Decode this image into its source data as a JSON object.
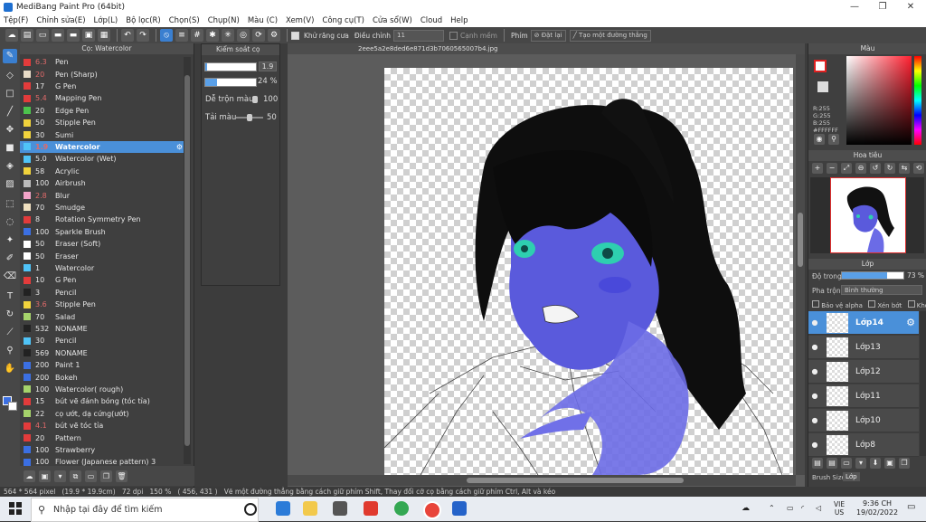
{
  "window": {
    "title": "MediBang Paint Pro (64bit)",
    "controls": {
      "minimize": "—",
      "maximize": "❐",
      "close": "✕"
    }
  },
  "menu": [
    "Tệp(F)",
    "Chỉnh sửa(E)",
    "Lớp(L)",
    "Bộ lọc(R)",
    "Chọn(S)",
    "Chụp(N)",
    "Màu (C)",
    "Xem(V)",
    "Công cụ(T)",
    "Cửa sổ(W)",
    "Cloud",
    "Help"
  ],
  "toolbar": {
    "antialias_label": "Khử răng cưa",
    "adjust_label": "Điều chỉnh",
    "adjust_value": "11",
    "soft_edge_label": "Cạnh mềm",
    "key_label": "Phím",
    "reset_label": "Đặt lại",
    "line_label": "Tạo một đường thẳng"
  },
  "brush_panel": {
    "title": "Cọ: Watercolor",
    "items": [
      {
        "size": "6.3",
        "name": "Pen",
        "color": "#e23b3b",
        "size_red": true
      },
      {
        "size": "20",
        "name": "Pen (Sharp)",
        "color": "#e8dcc8",
        "size_red": true
      },
      {
        "size": "17",
        "name": "G Pen",
        "color": "#e23b3b",
        "size_red": false
      },
      {
        "size": "5.4",
        "name": "Mapping Pen",
        "color": "#e23b3b",
        "size_red": true
      },
      {
        "size": "20",
        "name": "Edge Pen",
        "color": "#4cc24c",
        "size_red": false
      },
      {
        "size": "50",
        "name": "Stipple Pen",
        "color": "#f0d23c",
        "size_red": false
      },
      {
        "size": "30",
        "name": "Sumi",
        "color": "#f0d23c",
        "size_red": false
      },
      {
        "size": "1.9",
        "name": "Watercolor",
        "color": "#4fc3f7",
        "size_red": true,
        "selected": true
      },
      {
        "size": "5.0",
        "name": "Watercolor (Wet)",
        "color": "#4fc3f7",
        "size_red": false
      },
      {
        "size": "58",
        "name": "Acrylic",
        "color": "#f0d23c",
        "size_red": false
      },
      {
        "size": "100",
        "name": "Airbrush",
        "color": "#bbbbbb",
        "size_red": false
      },
      {
        "size": "2.8",
        "name": "Blur",
        "color": "#f2a3c8",
        "size_red": true
      },
      {
        "size": "70",
        "name": "Smudge",
        "color": "#f0e0c0",
        "size_red": false
      },
      {
        "size": "8",
        "name": "Rotation Symmetry Pen",
        "color": "#e23b3b",
        "size_red": false
      },
      {
        "size": "100",
        "name": "Sparkle Brush",
        "color": "#3b6fe2",
        "size_red": false
      },
      {
        "size": "50",
        "name": "Eraser (Soft)",
        "color": "#ffffff",
        "size_red": false
      },
      {
        "size": "50",
        "name": "Eraser",
        "color": "#ffffff",
        "size_red": false
      },
      {
        "size": "1",
        "name": "Watercolor",
        "color": "#4fc3f7",
        "size_red": false
      },
      {
        "size": "10",
        "name": "G Pen",
        "color": "#e23b3b",
        "size_red": false
      },
      {
        "size": "3",
        "name": "Pencil",
        "color": "#222222",
        "size_red": false
      },
      {
        "size": "3.6",
        "name": "Stipple Pen",
        "color": "#f0d23c",
        "size_red": true
      },
      {
        "size": "70",
        "name": "Salad",
        "color": "#a5d36b",
        "size_red": false
      },
      {
        "size": "532",
        "name": "NONAME",
        "color": "#222222",
        "size_red": false
      },
      {
        "size": "30",
        "name": "Pencil",
        "color": "#4fc3f7",
        "size_red": false
      },
      {
        "size": "569",
        "name": "NONAME",
        "color": "#222222",
        "size_red": false
      },
      {
        "size": "200",
        "name": "Paint 1",
        "color": "#3b6fe2",
        "size_red": false
      },
      {
        "size": "200",
        "name": "Bokeh",
        "color": "#3b6fe2",
        "size_red": false
      },
      {
        "size": "100",
        "name": "Watercolor( rough)",
        "color": "#a5d36b",
        "size_red": false
      },
      {
        "size": "15",
        "name": "bút vẽ đánh bóng (tóc tỉa)",
        "color": "#e23b3b",
        "size_red": false
      },
      {
        "size": "22",
        "name": "cọ ướt, dạ cứng(ướt)",
        "color": "#a5d36b",
        "size_red": false
      },
      {
        "size": "4.1",
        "name": "bút vẽ tóc tỉa",
        "color": "#e23b3b",
        "size_red": true
      },
      {
        "size": "20",
        "name": "Pattern",
        "color": "#e23b3b",
        "size_red": false
      },
      {
        "size": "100",
        "name": "Strawberry",
        "color": "#3b6fe2",
        "size_red": false
      },
      {
        "size": "100",
        "name": "Flower (Japanese pattern) 3",
        "color": "#3b6fe2",
        "size_red": false
      }
    ]
  },
  "brush_control": {
    "title": "Kiểm soát cọ",
    "size_value": "1.9",
    "opacity_value": "24 %",
    "opacity_fraction": 0.24,
    "blend_label": "Dễ trộn màu",
    "blend_value": "100",
    "reload_label": "Tải màu",
    "reload_value": "50"
  },
  "canvas": {
    "tab_name": "2eee5a2e8ded6e871d3b7060565007b4.jpg"
  },
  "color_panel": {
    "title": "Màu",
    "r": "R:255",
    "g": "G:255",
    "b": "B:255",
    "hex": "#FFFFFF"
  },
  "navigator": {
    "title": "Hoa tiêu"
  },
  "layer_panel": {
    "title": "Lớp",
    "opacity_label": "Độ trong",
    "opacity_value": "73 %",
    "opacity_fraction": 0.73,
    "blend_label": "Pha trộn",
    "blend_value": "Bình thường",
    "protect_alpha": "Bảo vệ alpha",
    "clip": "Xén bớt",
    "lock": "Khóa",
    "layers": [
      {
        "name": "Lớp14",
        "selected": true
      },
      {
        "name": "Lớp13"
      },
      {
        "name": "Lớp12"
      },
      {
        "name": "Lớp11"
      },
      {
        "name": "Lớp10"
      },
      {
        "name": "Lớp8"
      }
    ],
    "bottom_tab_1": "Brush Size",
    "bottom_tab_2": "Lớp"
  },
  "status": {
    "size": "564 * 564 pixel",
    "physical": "(19.9 * 19.9cm)",
    "dpi": "72 dpi",
    "zoom": "150 %",
    "coords": "( 456, 431 )",
    "hint": "Vẽ một đường thẳng bằng cách giữ phím Shift, Thay đổi cỡ cọ bằng cách giữ phím Ctrl, Alt và kéo"
  },
  "taskbar": {
    "search_placeholder": "Nhập tại đây để tìm kiếm",
    "lang1": "VIE",
    "lang2": "US",
    "time": "9:36 CH",
    "date": "19/02/2022"
  }
}
